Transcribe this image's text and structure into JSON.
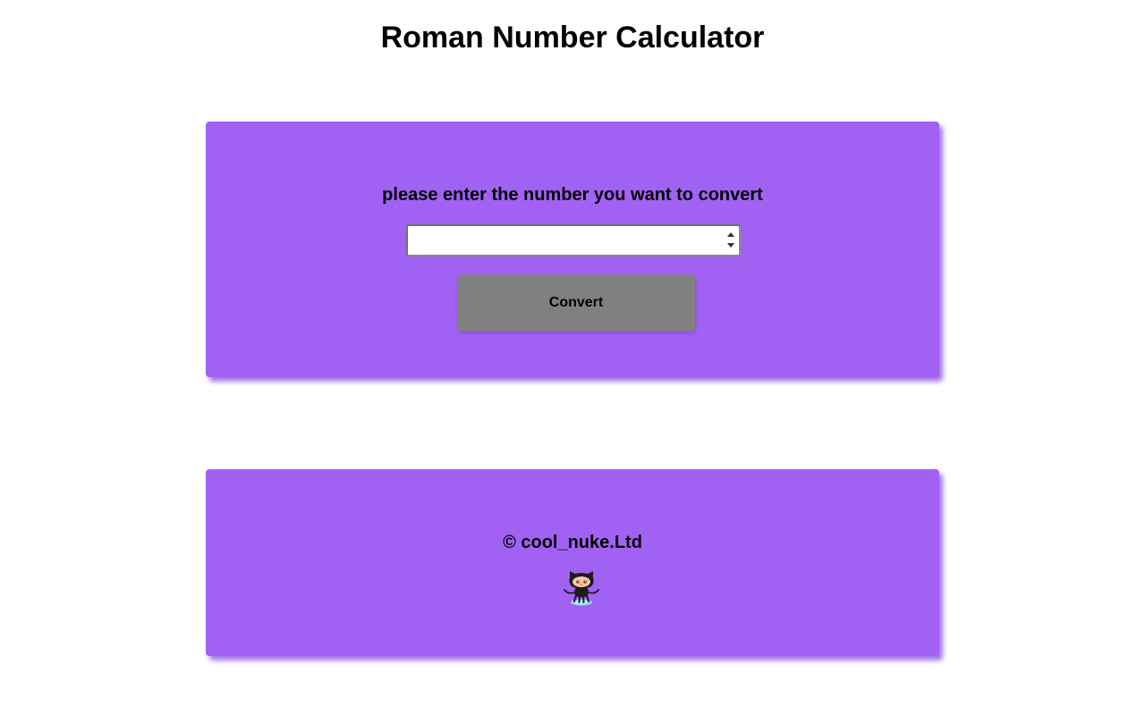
{
  "header": {
    "title": "Roman Number Calculator"
  },
  "converter": {
    "prompt": "please enter the number you want to convert",
    "input_value": "",
    "button_label": "Convert"
  },
  "footer": {
    "copyright": "© cool_nuke.Ltd",
    "logo_icon": "github-octocat-icon"
  },
  "colors": {
    "card_background": "#a162f4",
    "button_background": "#808080",
    "page_background": "#ffffff"
  }
}
